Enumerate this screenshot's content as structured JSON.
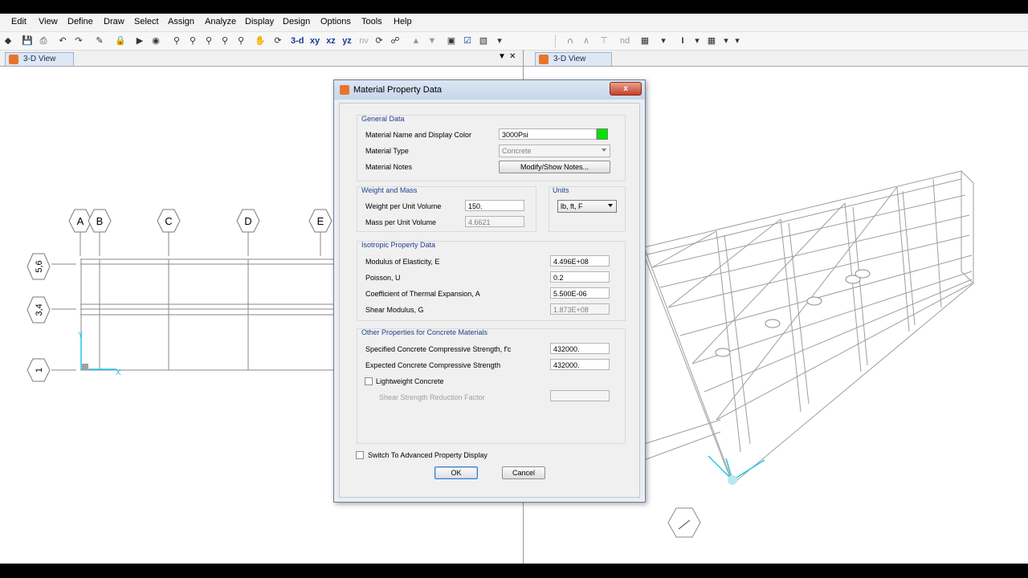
{
  "menu": [
    "Edit",
    "View",
    "Define",
    "Draw",
    "Select",
    "Assign",
    "Analyze",
    "Display",
    "Design",
    "Options",
    "Tools",
    "Help"
  ],
  "toolbar": {
    "b3d": "3-d",
    "bxy": "xy",
    "bxz": "xz",
    "byz": "yz",
    "bnv": "nv",
    "bnd": "nd",
    "bI": "I"
  },
  "tabs": {
    "left": "3-D View",
    "right": "3-D View"
  },
  "grid": {
    "columns": [
      "A",
      "B",
      "C",
      "D",
      "E"
    ],
    "rows": [
      "5,6",
      "3,4",
      "1"
    ]
  },
  "dialog": {
    "title": "Material Property Data",
    "close": "x",
    "general": {
      "title": "General Data",
      "name_label": "Material Name and Display Color",
      "name_value": "3000Psi",
      "color": "#00e600",
      "type_label": "Material Type",
      "type_value": "Concrete",
      "notes_label": "Material Notes",
      "notes_button": "Modify/Show Notes..."
    },
    "weight": {
      "title": "Weight and Mass",
      "weight_label": "Weight per Unit Volume",
      "weight_value": "150.",
      "mass_label": "Mass per Unit Volume",
      "mass_value": "4.6621"
    },
    "units": {
      "title": "Units",
      "value": "lb, ft, F"
    },
    "isotropic": {
      "title": "Isotropic Property Data",
      "modulus_label": "Modulus of Elasticity,  E",
      "modulus_value": "4.496E+08",
      "poisson_label": "Poisson,  U",
      "poisson_value": "0.2",
      "thermal_label": "Coefficient of Thermal Expansion,  A",
      "thermal_value": "5.500E-06",
      "shear_label": "Shear Modulus,  G",
      "shear_value": "1.873E+08"
    },
    "concrete": {
      "title": "Other Properties for Concrete Materials",
      "fc_label": "Specified Concrete Compressive Strength, f'c",
      "fc_value": "432000.",
      "expected_label": "Expected Concrete Compressive Strength",
      "expected_value": "432000.",
      "lightweight_label": "Lightweight Concrete",
      "shear_reduction_label": "Shear Strength Reduction Factor",
      "shear_reduction_value": ""
    },
    "advanced_label": "Switch To Advanced Property Display",
    "ok": "OK",
    "cancel": "Cancel"
  }
}
